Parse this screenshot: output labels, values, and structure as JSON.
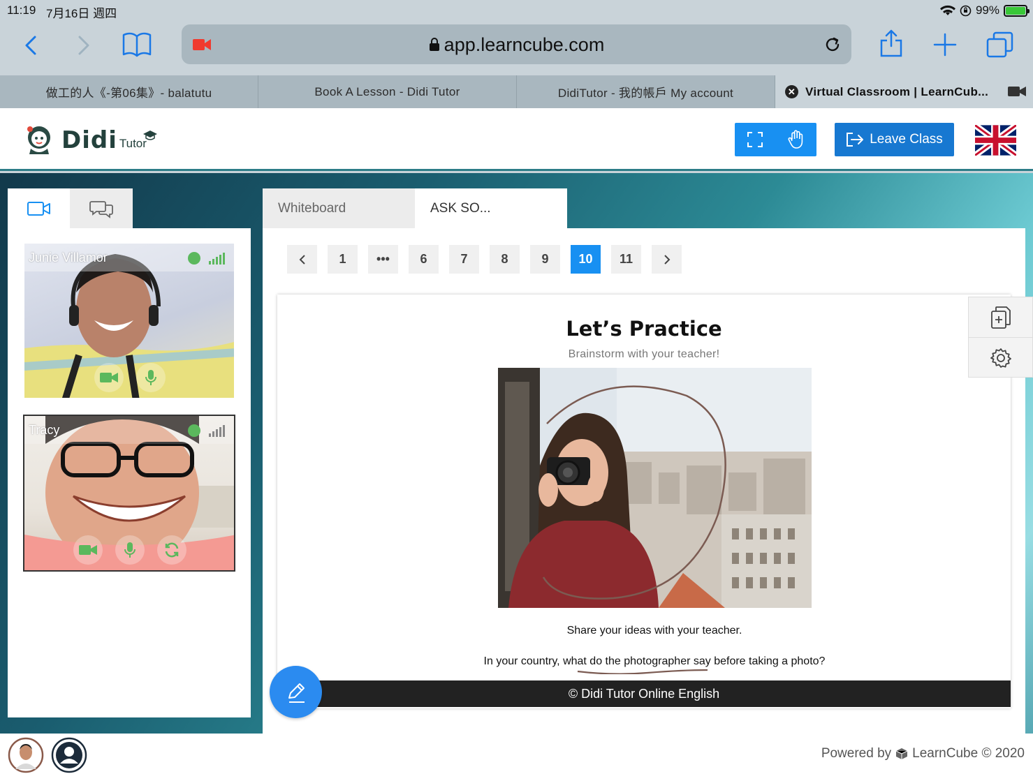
{
  "status": {
    "time": "11:19",
    "date": "7月16日 週四",
    "battery": "99%",
    "battery_level": 0.99
  },
  "browser": {
    "url": "app.learncube.com",
    "tabs": [
      {
        "label": "做工的人《-第06集》- balatutu"
      },
      {
        "label": "Book A Lesson - Didi Tutor"
      },
      {
        "label": "DidiTutor - 我的帳戶 My account"
      },
      {
        "label": "Virtual Classroom | LearnCub..."
      }
    ]
  },
  "header": {
    "brand": "Didi",
    "brand_sub": "Tutor",
    "leave_label": "Leave Class"
  },
  "left_panel": {
    "participants": [
      {
        "name": "Junie Villamor",
        "status_color": "#5bb85d"
      },
      {
        "name": "Tracy",
        "status_color": "#5bb85d"
      }
    ]
  },
  "right_panel": {
    "tabs": [
      {
        "label": "Whiteboard"
      },
      {
        "label": "ASK SO..."
      }
    ],
    "pager": {
      "items": [
        "1",
        "•••",
        "6",
        "7",
        "8",
        "9",
        "10",
        "11"
      ],
      "current": "10"
    },
    "slide": {
      "title": "Let’s Practice",
      "subtitle": "Brainstorm with your teacher!",
      "line1": "Share your ideas with your teacher.",
      "line2": "In your country, what do the photographer say before taking a photo?",
      "footer": "© Didi Tutor Online English"
    }
  },
  "footer": {
    "powered_prefix": "Powered by",
    "powered_brand": "LearnCube © 2020"
  },
  "colors": {
    "accent": "#1890f2",
    "leave": "#1778d1",
    "status_green": "#5bb85d"
  }
}
